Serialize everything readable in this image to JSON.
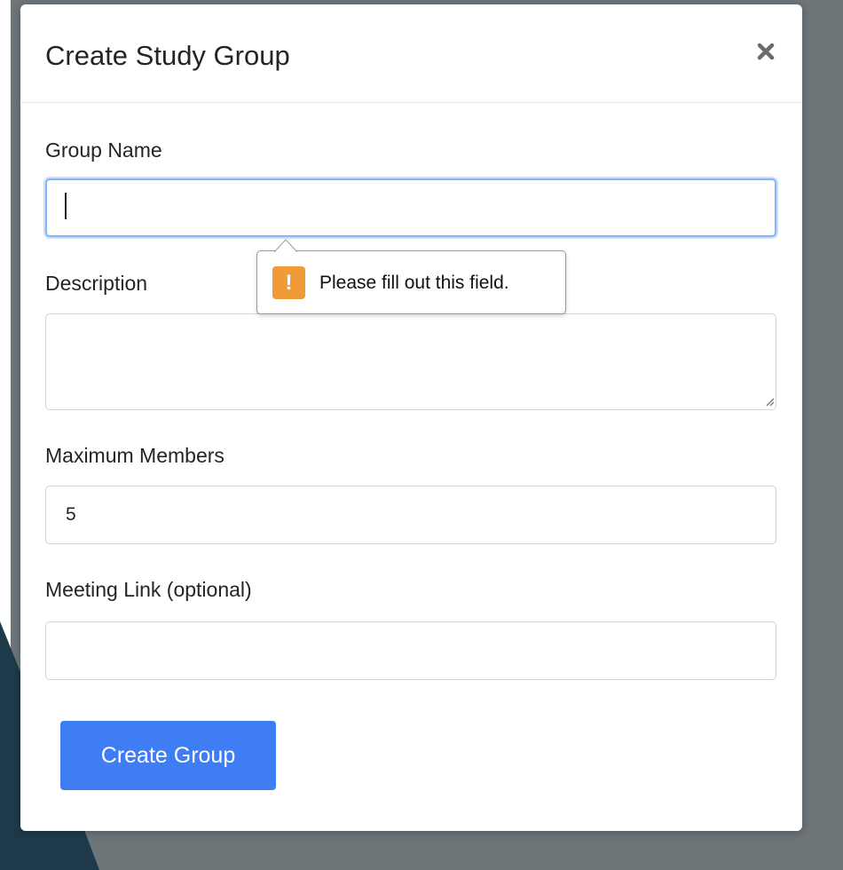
{
  "modal": {
    "title": "Create Study Group",
    "close_icon": "close-icon",
    "fields": {
      "group_name": {
        "label": "Group Name",
        "value": "",
        "validation_message": "Please fill out this field.",
        "validation_icon": "warning-icon"
      },
      "description": {
        "label": "Description",
        "value": ""
      },
      "max_members": {
        "label": "Maximum Members",
        "value": "5"
      },
      "meeting_link": {
        "label": "Meeting Link (optional)",
        "value": ""
      }
    },
    "submit_label": "Create Group"
  },
  "colors": {
    "backdrop": "#6d7579",
    "accent": "#3e7df3",
    "focus_ring": "#89b5f6",
    "warning": "#f19a38"
  }
}
